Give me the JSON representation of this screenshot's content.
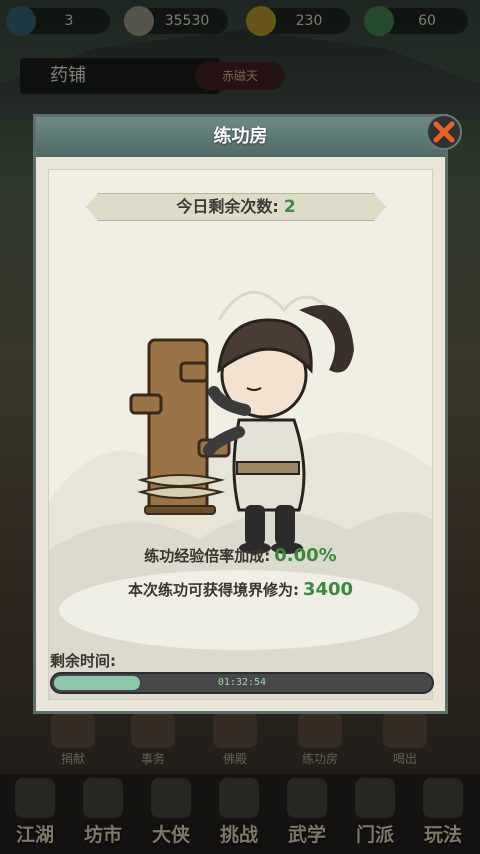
{
  "topbar": {
    "stamina": "3",
    "silver": "35530",
    "gold": "230",
    "jade": "60"
  },
  "background": {
    "title": "药铺",
    "tag": "赤磁天"
  },
  "secondary_row": [
    "捐献",
    "事务",
    "佛殿",
    "练功房",
    "喝出"
  ],
  "bottom_nav": [
    "江湖",
    "坊市",
    "大侠",
    "挑战",
    "武学",
    "门派",
    "玩法"
  ],
  "dialog": {
    "title": "练功房",
    "remaining_label": "今日剩余次数:",
    "remaining_value": "2",
    "bonus_label": "练功经验倍率加成:",
    "bonus_value": "0.00%",
    "reward_label": "本次练功可获得境界修为:",
    "reward_value": "3400",
    "time_label": "剩余时间:",
    "timer": "01:32:54",
    "progress_fraction": 0.23
  },
  "colors": {
    "accent_green": "#3a8a3e",
    "header_teal": "#5d7a76",
    "close_orange": "#e8612c"
  },
  "icons": [
    "close-icon",
    "wooden-dummy-icon",
    "martial-artist-character"
  ]
}
